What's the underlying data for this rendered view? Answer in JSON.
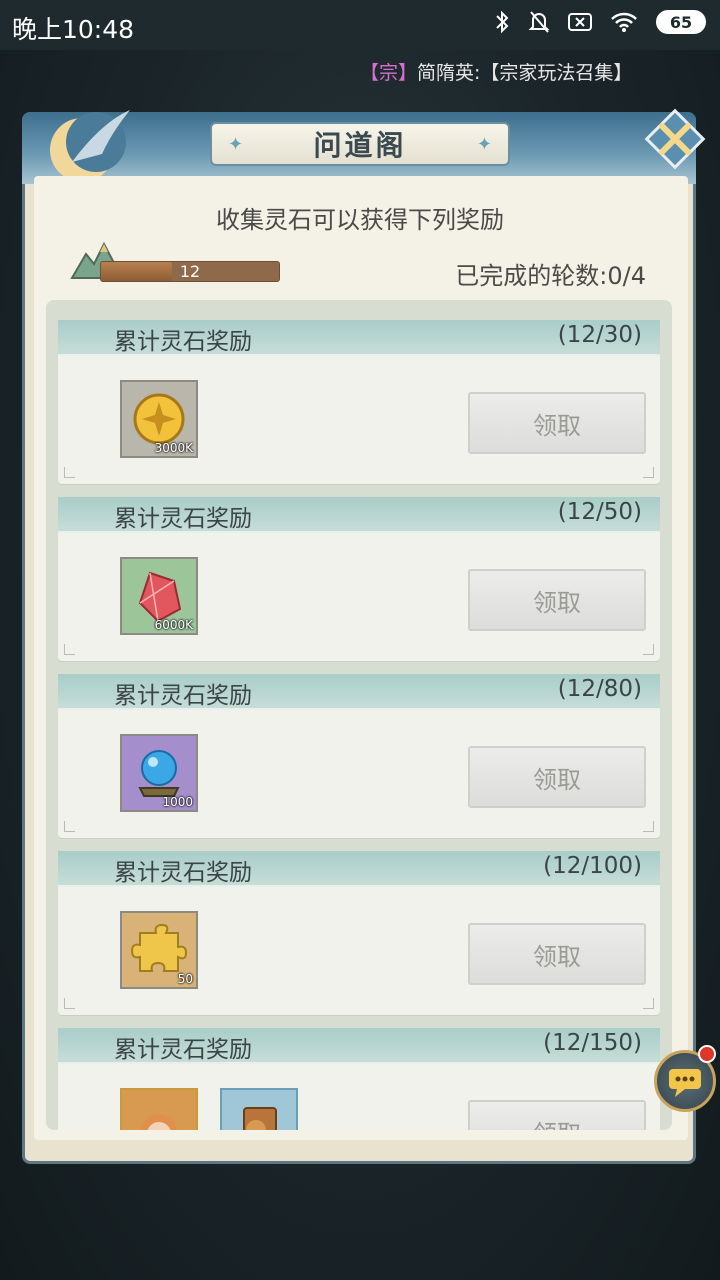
{
  "status_bar": {
    "time": "晚上10:48",
    "battery": "65"
  },
  "announcement": {
    "tag": "【宗】",
    "text": "简隋英:【宗家玩法召集】"
  },
  "panel": {
    "title": "问道阁",
    "subtitle": "收集灵石可以获得下列奖励",
    "progress_value": "12",
    "progress_fraction": 0.4,
    "rounds_label": "已完成的轮数:0/4"
  },
  "rewards": [
    {
      "title": "累计灵石奖励",
      "count": "(12/30)",
      "item_qty": "3000K",
      "item_icon": "gold-coin-icon",
      "item_bg": "#b9b6ab",
      "button": "领取"
    },
    {
      "title": "累计灵石奖励",
      "count": "(12/50)",
      "item_qty": "6000K",
      "item_icon": "red-crystal-icon",
      "item_bg": "#9cc59a",
      "button": "领取"
    },
    {
      "title": "累计灵石奖励",
      "count": "(12/80)",
      "item_qty": "1000",
      "item_icon": "blue-orb-icon",
      "item_bg": "#a48ecb",
      "button": "领取"
    },
    {
      "title": "累计灵石奖励",
      "count": "(12/100)",
      "item_qty": "50",
      "item_icon": "gold-puzzle-icon",
      "item_bg": "#d8b276",
      "button": "领取"
    },
    {
      "title": "累计灵石奖励",
      "count": "(12/150)",
      "item_qty": "",
      "item_icon": "character-portrait-icon",
      "item_bg": "#d89a50",
      "button": "领取"
    }
  ]
}
